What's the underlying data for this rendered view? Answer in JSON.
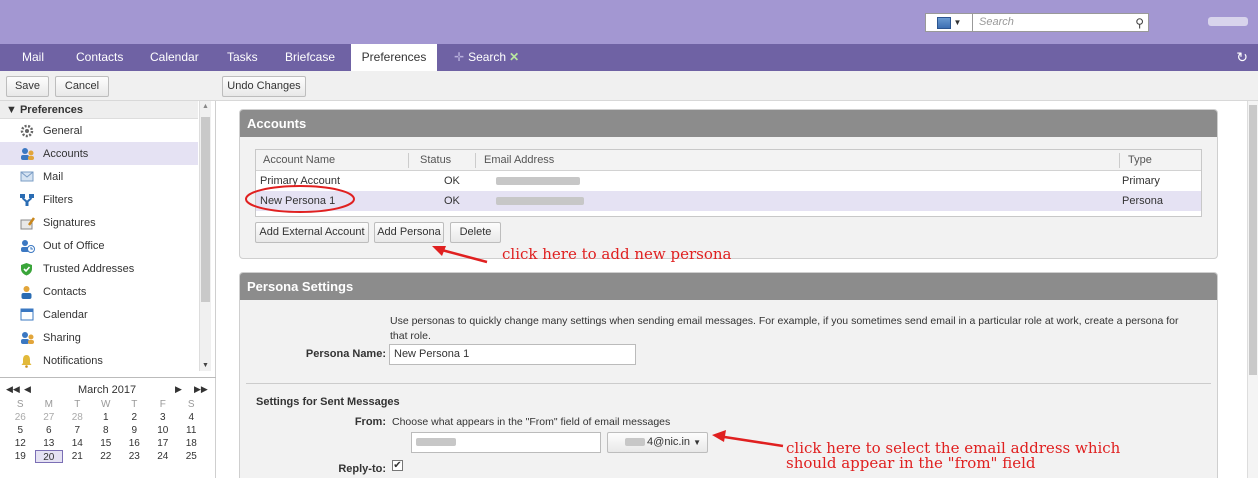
{
  "header": {
    "search_placeholder": "Search",
    "search_scope_icon": "calendar-icon"
  },
  "nav": {
    "tabs": [
      "Mail",
      "Contacts",
      "Calendar",
      "Tasks",
      "Briefcase",
      "Preferences",
      "Search"
    ],
    "active": "Preferences"
  },
  "toolbar": {
    "save": "Save",
    "cancel": "Cancel",
    "undo": "Undo Changes"
  },
  "sidebar": {
    "header": "Preferences",
    "items": [
      {
        "label": "General",
        "icon": "gear-icon"
      },
      {
        "label": "Accounts",
        "icon": "accounts-icon",
        "selected": true
      },
      {
        "label": "Mail",
        "icon": "mail-icon"
      },
      {
        "label": "Filters",
        "icon": "filter-icon"
      },
      {
        "label": "Signatures",
        "icon": "signature-icon"
      },
      {
        "label": "Out of Office",
        "icon": "out-of-office-icon"
      },
      {
        "label": "Trusted Addresses",
        "icon": "shield-icon"
      },
      {
        "label": "Contacts",
        "icon": "contact-icon"
      },
      {
        "label": "Calendar",
        "icon": "calendar-icon"
      },
      {
        "label": "Sharing",
        "icon": "sharing-icon"
      },
      {
        "label": "Notifications",
        "icon": "bell-icon"
      }
    ]
  },
  "minical": {
    "title": "March 2017",
    "dow": [
      "S",
      "M",
      "T",
      "W",
      "T",
      "F",
      "S"
    ],
    "weeks": [
      [
        "26",
        "27",
        "28",
        "1",
        "2",
        "3",
        "4"
      ],
      [
        "5",
        "6",
        "7",
        "8",
        "9",
        "10",
        "11"
      ],
      [
        "12",
        "13",
        "14",
        "15",
        "16",
        "17",
        "18"
      ],
      [
        "19",
        "20",
        "21",
        "22",
        "23",
        "24",
        "25"
      ]
    ],
    "today": "20"
  },
  "accounts": {
    "title": "Accounts",
    "columns": [
      "Account Name",
      "Status",
      "Email Address",
      "Type"
    ],
    "rows": [
      {
        "name": "Primary Account",
        "status": "OK",
        "type": "Primary"
      },
      {
        "name": "New Persona 1",
        "status": "OK",
        "type": "Persona"
      }
    ],
    "buttons": {
      "add_external": "Add External Account",
      "add_persona": "Add Persona",
      "delete": "Delete"
    }
  },
  "persona": {
    "title": "Persona Settings",
    "description": "Use personas to quickly change many settings when sending email messages. For example, if you sometimes send email in a particular role at work, create a persona for that role.",
    "name_label": "Persona Name:",
    "name_value": "New Persona 1",
    "sent_heading": "Settings for Sent Messages",
    "from_label": "From:",
    "from_help": "Choose what appears in the \"From\" field of email messages",
    "from_domain": "4@nic.in",
    "reply_label": "Reply-to:"
  },
  "annotations": {
    "add_persona": "click here to add new persona",
    "from_line1": "click here to select the email address which",
    "from_line2": "should appear in the \"from\" field"
  },
  "colors": {
    "banner": "#a397d2",
    "nav": "#6f62a4",
    "annotation": "#e02020",
    "selection": "#e5e2f3"
  }
}
